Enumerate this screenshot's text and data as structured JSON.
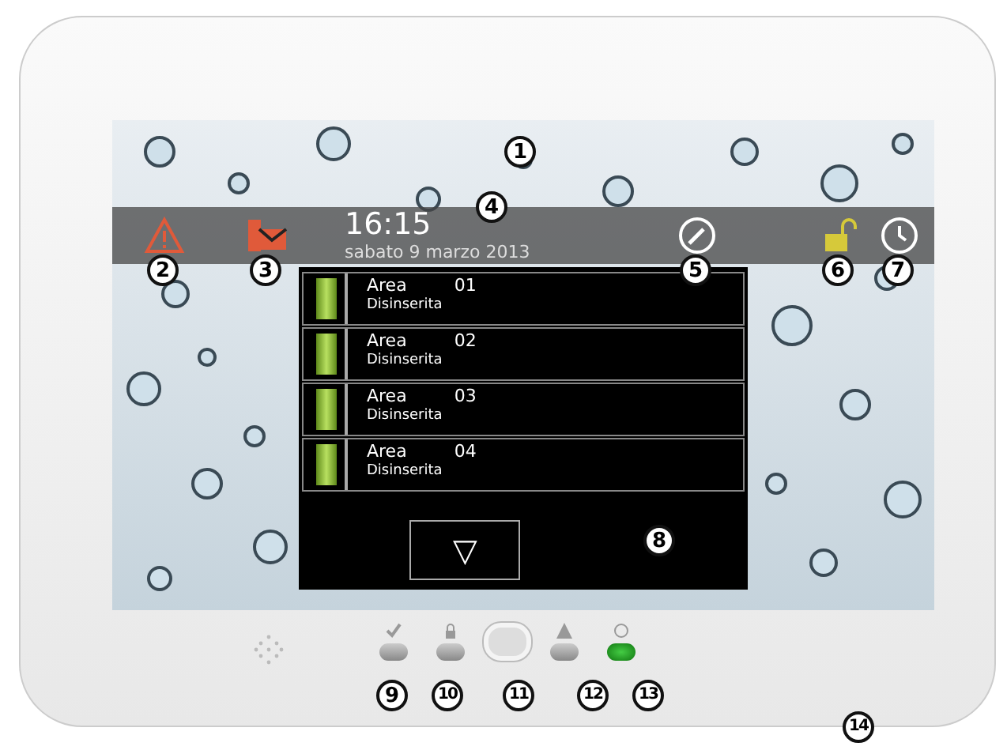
{
  "status_bar": {
    "time": "16:15",
    "date": "sabato 9 marzo 2013"
  },
  "areas": [
    {
      "label": "Area",
      "number": "01",
      "state": "Disinserita"
    },
    {
      "label": "Area",
      "number": "02",
      "state": "Disinserita"
    },
    {
      "label": "Area",
      "number": "03",
      "state": "Disinserita"
    },
    {
      "label": "Area",
      "number": "04",
      "state": "Disinserita"
    }
  ],
  "scroll_button": {
    "label": "▽"
  },
  "leds": [
    {
      "kind": "check",
      "lit": false
    },
    {
      "kind": "lock",
      "lit": false
    },
    {
      "kind": "button",
      "lit": false
    },
    {
      "kind": "warning",
      "lit": false
    },
    {
      "kind": "power",
      "lit": true
    }
  ],
  "callouts": [
    "1",
    "2",
    "3",
    "4",
    "5",
    "6",
    "7",
    "8",
    "9",
    "10",
    "11",
    "12",
    "13",
    "14"
  ]
}
